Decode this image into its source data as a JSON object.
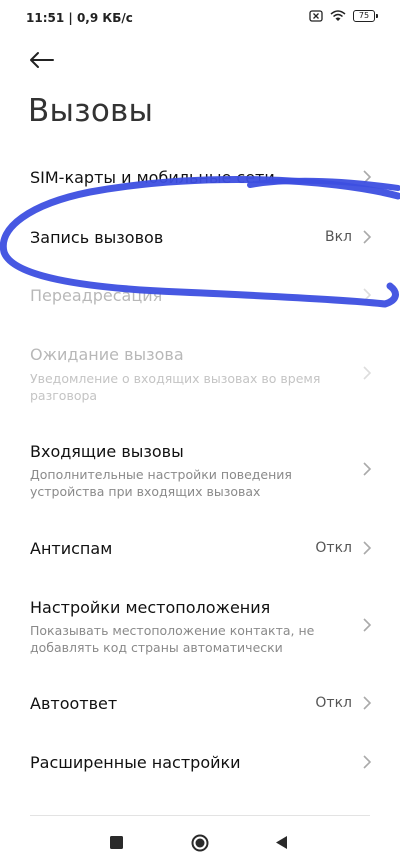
{
  "status": {
    "time": "11:51",
    "speed": "| 0,9 КБ/с",
    "battery": "75"
  },
  "header": {
    "title": "Вызовы"
  },
  "settings": {
    "items": [
      {
        "title": "SIM-карты и мобильные сети",
        "subtitle": "",
        "value": ""
      },
      {
        "title": "Запись вызовов",
        "subtitle": "",
        "value": "Вкл"
      },
      {
        "title": "Переадресация",
        "subtitle": "",
        "value": ""
      },
      {
        "title": "Ожидание вызова",
        "subtitle": "Уведомление о входящих вызовах во время разговора",
        "value": ""
      },
      {
        "title": "Входящие вызовы",
        "subtitle": "Дополнительные настройки поведения устройства при входящих вызовах",
        "value": ""
      },
      {
        "title": "Антиспам",
        "subtitle": "",
        "value": "Откл"
      },
      {
        "title": "Настройки местоположения",
        "subtitle": "Показывать местоположение контакта, не добавлять код страны автоматически",
        "value": ""
      },
      {
        "title": "Автоответ",
        "subtitle": "",
        "value": "Откл"
      },
      {
        "title": "Расширенные настройки",
        "subtitle": "",
        "value": ""
      }
    ]
  },
  "colors": {
    "annotation": "#3d4fe0",
    "disabled": "#b8b8b8",
    "secondary": "#8a8a8a"
  }
}
